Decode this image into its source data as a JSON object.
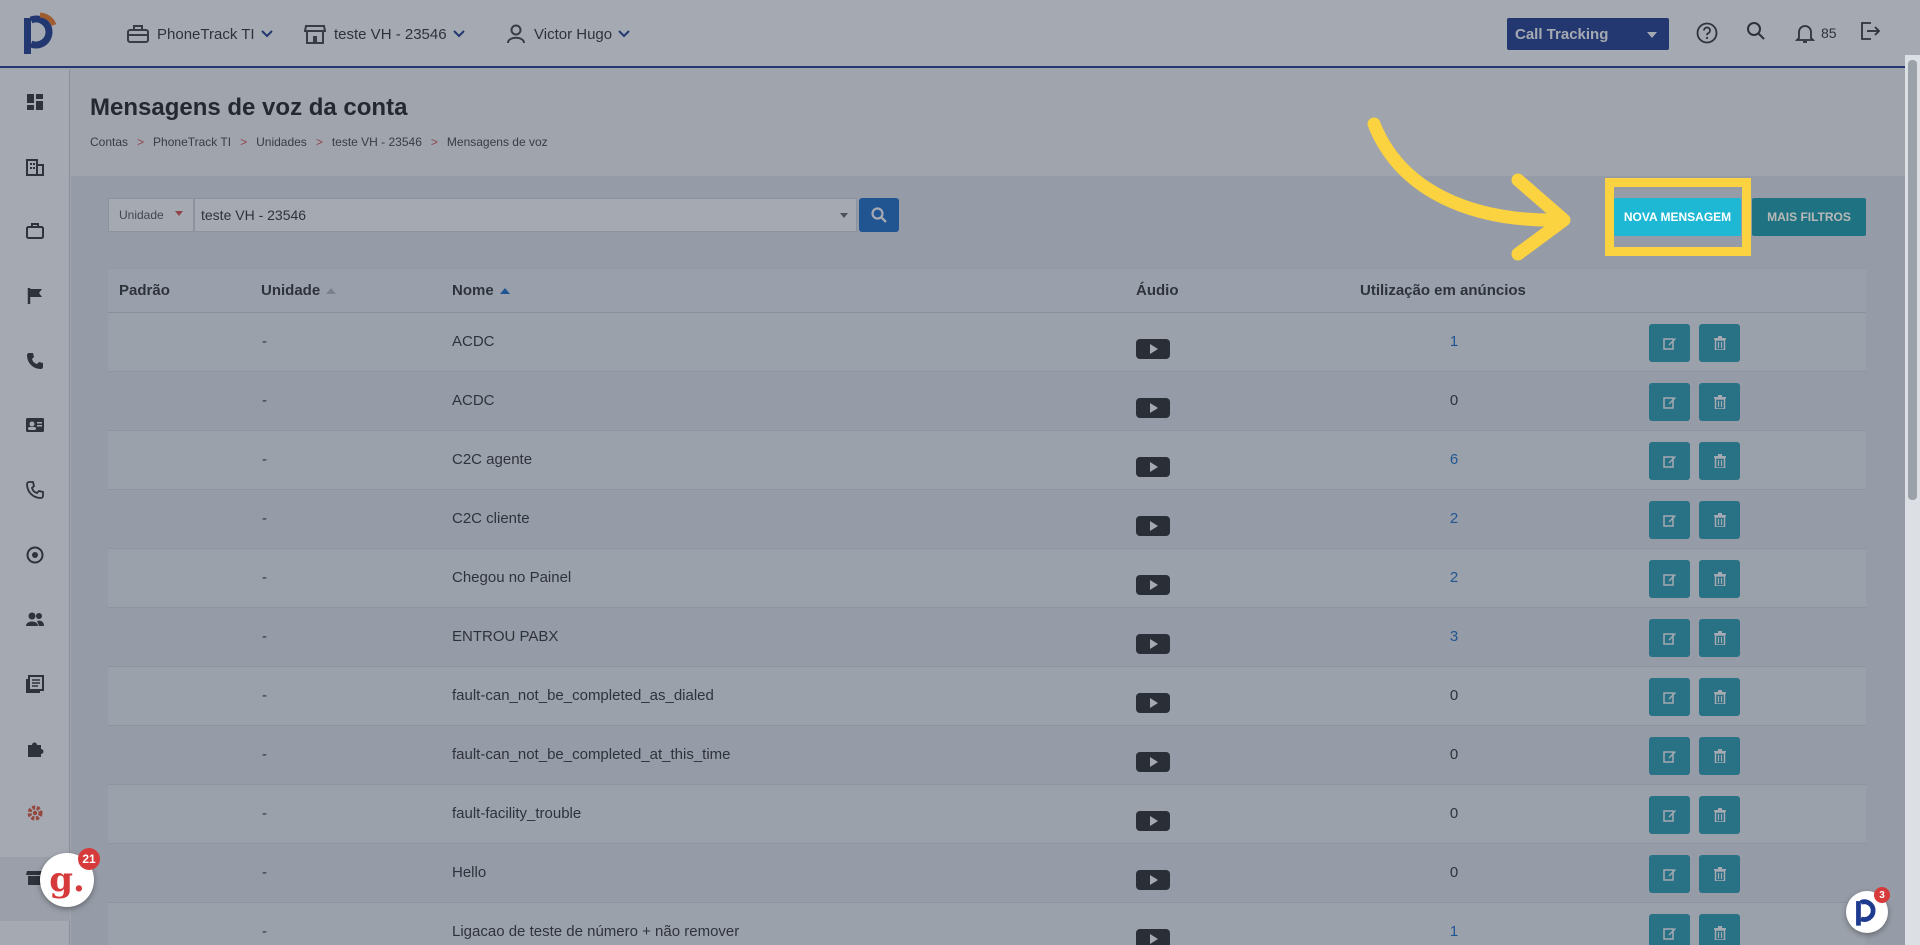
{
  "topbar": {
    "account": "PhoneTrack TI",
    "unit": "teste VH - 23546",
    "user": "Victor Hugo",
    "product": "Call Tracking",
    "notifications": "85"
  },
  "page": {
    "title": "Mensagens de voz da conta",
    "breadcrumb": [
      "Contas",
      "PhoneTrack TI",
      "Unidades",
      "teste VH - 23546",
      "Mensagens de voz"
    ]
  },
  "filters": {
    "unit_label": "Unidade",
    "unit_value": "teste VH - 23546",
    "new_message": "NOVA MENSAGEM",
    "more_filters": "MAIS FILTROS"
  },
  "table": {
    "headers": {
      "default": "Padrão",
      "unit": "Unidade",
      "name": "Nome",
      "audio": "Áudio",
      "usage": "Utilização em anúncios"
    },
    "rows": [
      {
        "unit": "-",
        "name": "ACDC",
        "usage": "1"
      },
      {
        "unit": "-",
        "name": "ACDC",
        "usage": "0"
      },
      {
        "unit": "-",
        "name": "C2C agente",
        "usage": "6"
      },
      {
        "unit": "-",
        "name": "C2C cliente",
        "usage": "2"
      },
      {
        "unit": "-",
        "name": "Chegou no Painel",
        "usage": "2"
      },
      {
        "unit": "-",
        "name": "ENTROU PABX",
        "usage": "3"
      },
      {
        "unit": "-",
        "name": "fault-can_not_be_completed_as_dialed",
        "usage": "0"
      },
      {
        "unit": "-",
        "name": "fault-can_not_be_completed_at_this_time",
        "usage": "0"
      },
      {
        "unit": "-",
        "name": "fault-facility_trouble",
        "usage": "0"
      },
      {
        "unit": "-",
        "name": "Hello",
        "usage": "0"
      },
      {
        "unit": "-",
        "name": "Ligacao de teste de número + não remover",
        "usage": "1"
      }
    ]
  },
  "badges": {
    "g_count": "21",
    "p_count": "3",
    "g_letter": "g."
  },
  "colors": {
    "primary": "#1f3b8f",
    "accent": "#1eb7d4",
    "action": "#2a9fb3",
    "highlight": "#fbd23f",
    "link": "#1a6fc9"
  }
}
